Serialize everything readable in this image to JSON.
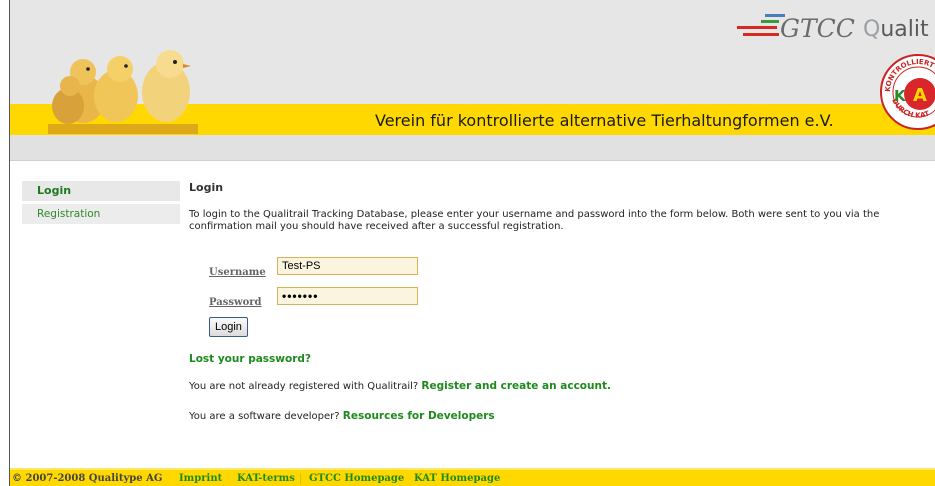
{
  "header": {
    "tagline": "Verein für kontrollierte alternative Tierhaltungformen e.V.",
    "gtcc_logo": "GTCC",
    "qualitrail_logo_q": "Q",
    "qualitrail_logo_rest": "ualit",
    "kat_logo_ring_top": "KONTROLLIERT",
    "kat_logo_ring_bottom": "DURCH KAT",
    "kat_logo_center": "A",
    "kat_logo_left": "K"
  },
  "sidebar": {
    "items": [
      {
        "label": "Login",
        "active": true
      },
      {
        "label": "Registration",
        "active": false
      }
    ]
  },
  "main": {
    "heading": "Login",
    "intro": "To login to the Qualitrail Tracking Database, please enter your username and password into the form below. Both were sent to you via the confirmation mail you should have received after a successful registration.",
    "username_label": "Username",
    "username_value": "Test-PS",
    "password_label": "Password",
    "password_value": "•••••••",
    "login_button": "Login",
    "lost_password": "Lost your password?",
    "not_registered_text": "You are not already registered with Qualitrail?",
    "register_link": "Register and create an account.",
    "developer_text": "You are a software developer?",
    "developer_link": "Resources for Developers"
  },
  "footer": {
    "copyright": "© 2007-2008 Qualitype AG",
    "links": [
      "Imprint",
      "KAT-terms",
      "GTCC Homepage",
      "KAT Homepage"
    ]
  },
  "colors": {
    "brand_yellow": "#ffd800",
    "link_green": "#1e8a1e",
    "header_gray": "#e6e6e6"
  }
}
